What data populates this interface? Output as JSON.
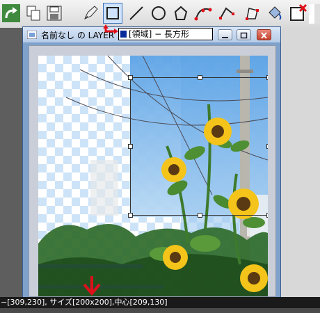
{
  "toolbar": {
    "tools": [
      {
        "icon": "redo-arrow-icon"
      },
      {
        "icon": "copy-pages-icon"
      },
      {
        "icon": "save-disk-icon"
      },
      {
        "icon": "pen-brush-icon"
      },
      {
        "icon": "rectangle-tool-icon",
        "active": true
      },
      {
        "icon": "line-tool-icon"
      },
      {
        "icon": "ellipse-tool-icon"
      },
      {
        "icon": "polygon-tool-icon"
      },
      {
        "icon": "bezier-curve-icon"
      },
      {
        "icon": "path-edit-icon"
      },
      {
        "icon": "transform-icon"
      },
      {
        "icon": "fill-bucket-icon"
      },
      {
        "icon": "delete-selection-icon"
      }
    ]
  },
  "window": {
    "title": "名前なし の LAYER",
    "buttons": {
      "minimize": "minimize-icon",
      "maximize": "maximize-icon",
      "close": "close-icon"
    }
  },
  "tooltip": {
    "text": "[領域] − 長方形"
  },
  "status": {
    "text": "−[309,230], サイズ[200x200],中心[209,130]"
  },
  "colors": {
    "accent_red": "#e0101a",
    "selection_border": "#333333",
    "status_bg": "#1a1a1a",
    "window_frame": "#7fa2cc"
  }
}
